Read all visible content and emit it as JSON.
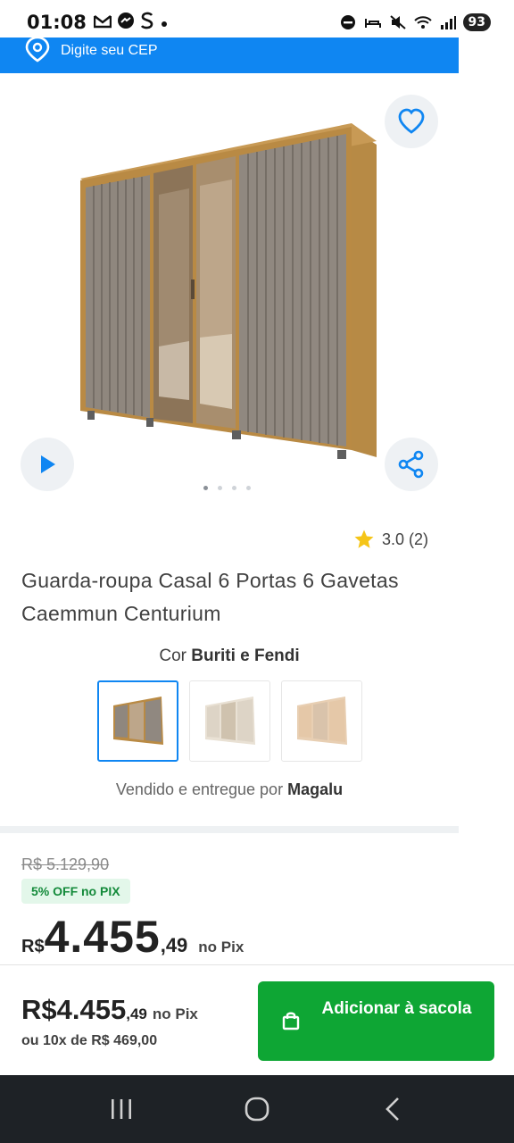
{
  "status_bar": {
    "time": "01:08",
    "notification_icons": [
      "gmail-icon",
      "messenger-icon",
      "s-app-icon",
      "dot"
    ],
    "battery": "93"
  },
  "cep_bar": {
    "text": "Digite seu CEP"
  },
  "gallery": {
    "dot_count": 4,
    "active_dot": 0
  },
  "rating": {
    "value": "3.0 (2)"
  },
  "product": {
    "title": "Guarda-roupa Casal 6 Portas 6 Gavetas Caemmun Centurium"
  },
  "color": {
    "label": "Cor",
    "selected": "Buriti e Fendi",
    "swatches": [
      "Buriti e Fendi",
      "off-white",
      "natural"
    ]
  },
  "seller": {
    "prefix": "Vendido e entregue por",
    "name": "Magalu"
  },
  "price": {
    "old": "R$ 5.129,90",
    "discount": "5% OFF no PIX",
    "currency": "R$",
    "integer": "4.455",
    "cents": ",49",
    "pix_label": "no Pix"
  },
  "buy_bar": {
    "price_integer": "R$4.455",
    "price_cents": ",49",
    "pix_label": "no Pix",
    "installments": "ou 10x de R$ 469,00",
    "add_button": "Adicionar à sacola"
  },
  "colors": {
    "primary_blue": "#0f86f2",
    "buy_green": "#0ea634",
    "star": "#f5c518"
  }
}
